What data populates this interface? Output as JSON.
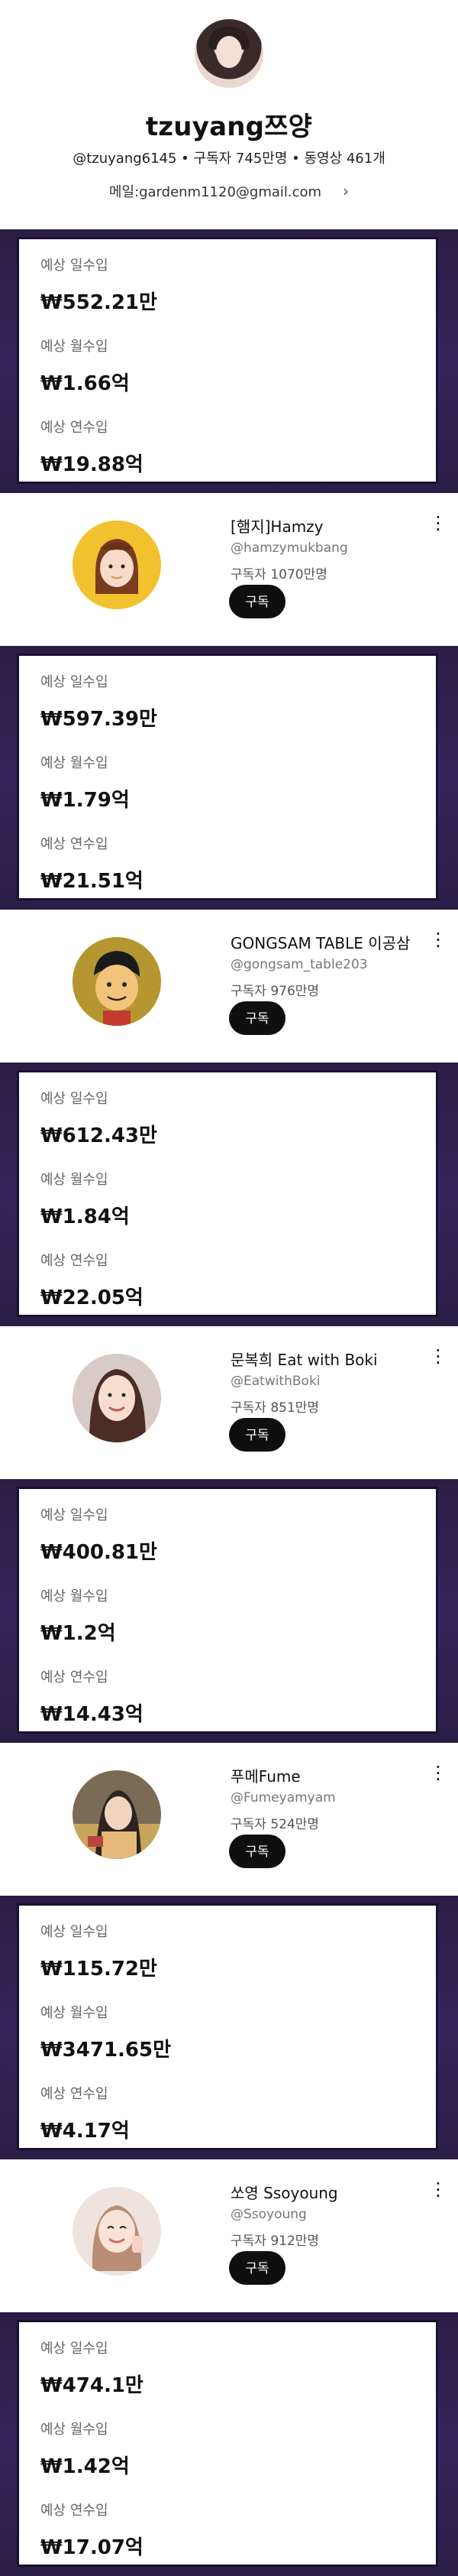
{
  "top": {
    "name": "tzuyang쯔양",
    "stats": "@tzuyang6145 • 구독자 745만명 • 동영상 461개",
    "email": "메일:gardenm1120@gmail.com",
    "email_chevron": "›"
  },
  "income_labels": {
    "daily": "예상 일수입",
    "monthly": "예상 월수입",
    "yearly": "예상 연수입"
  },
  "incomes": [
    {
      "daily": "₩552.21만",
      "monthly": "₩1.66억",
      "yearly": "₩19.88억"
    },
    {
      "daily": "₩597.39만",
      "monthly": "₩1.79억",
      "yearly": "₩21.51억"
    },
    {
      "daily": "₩612.43만",
      "monthly": "₩1.84억",
      "yearly": "₩22.05억"
    },
    {
      "daily": "₩400.81만",
      "monthly": "₩1.2억",
      "yearly": "₩14.43억"
    },
    {
      "daily": "₩115.72만",
      "monthly": "₩3471.65만",
      "yearly": "₩4.17억"
    },
    {
      "daily": "₩474.1만",
      "monthly": "₩1.42억",
      "yearly": "₩17.07억"
    }
  ],
  "channels": [
    {
      "name": "[햄지]Hamzy",
      "handle": "@hamzymukbang",
      "subs": "구독자 1070만명",
      "subscribe": "구독",
      "more": "⋮",
      "avatar_icon": "hamzy-avatar"
    },
    {
      "name": "GONGSAM TABLE 이공삼",
      "handle": "@gongsam_table203",
      "subs": "구독자 976만명",
      "subscribe": "구독",
      "more": "⋮",
      "avatar_icon": "gongsam-avatar"
    },
    {
      "name": "문복희 Eat with Boki",
      "handle": "@EatwithBoki",
      "subs": "구독자 851만명",
      "subscribe": "구독",
      "more": "⋮",
      "avatar_icon": "boki-avatar"
    },
    {
      "name": "푸메Fume",
      "handle": "@Fumeyamyam",
      "subs": "구독자 524만명",
      "subscribe": "구독",
      "more": "⋮",
      "avatar_icon": "fume-avatar"
    },
    {
      "name": "쏘영 Ssoyoung",
      "handle": "@Ssoyoung",
      "subs": "구독자 912만명",
      "subscribe": "구독",
      "more": "⋮",
      "avatar_icon": "ssoyoung-avatar"
    }
  ],
  "colors": {
    "income_bg": "#2b1e45",
    "button_bg": "#0f0f0f"
  }
}
